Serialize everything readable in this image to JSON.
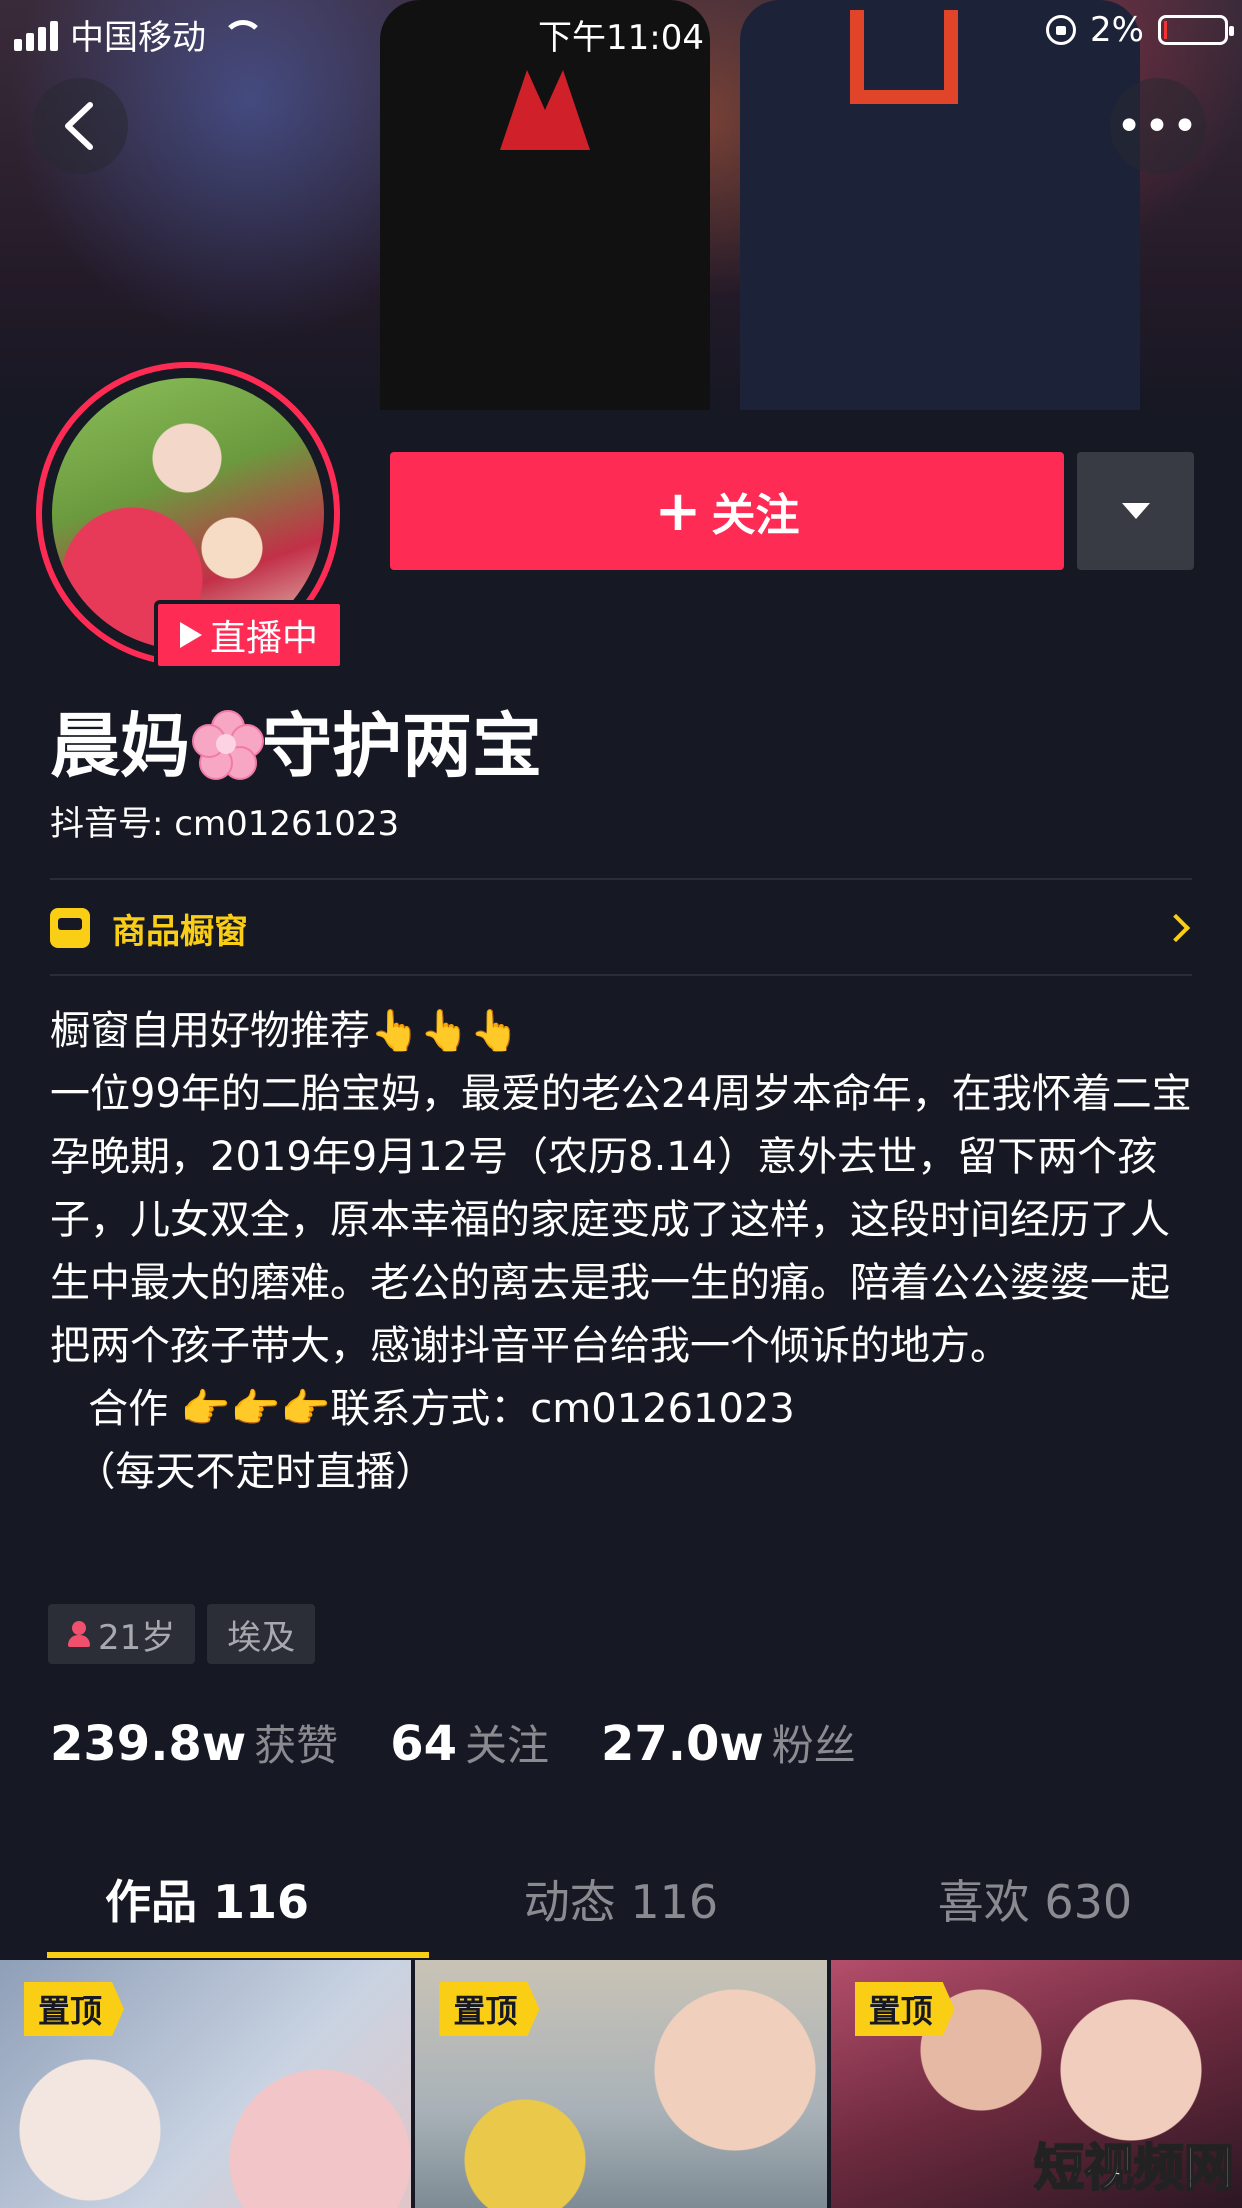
{
  "status_bar": {
    "carrier": "中国移动",
    "time": "下午11:04",
    "battery": "2%"
  },
  "header": {
    "back_icon": "chevron-left-icon",
    "more_icon": "more-dots-icon",
    "more_label": "•••"
  },
  "profile": {
    "live_badge": "直播中",
    "follow_label": "关注",
    "follow_plus": "+",
    "nickname_part1": "晨妈",
    "nickname_emoji": "cherry-blossom-icon",
    "nickname_part2": "守护两宝",
    "douyin_id": "抖音号: cm01261023"
  },
  "shop": {
    "label": "商品橱窗"
  },
  "bio": "橱窗自用好物推荐👆👆👆\n一位99年的二胎宝妈，最爱的老公24周岁本命年，在我怀着二宝孕晚期，2019年9月12号（农历8.14）意外去世，留下两个孩子，儿女双全，原本幸福的家庭变成了这样，这段时间经历了人生中最大的磨难。老公的离去是我一生的痛。陪着公公婆婆一起把两个孩子带大，感谢抖音平台给我一个倾诉的地方。\n   合作 👉👉👉联系方式：cm01261023\n  （每天不定时直播）",
  "tags": {
    "age": "21岁",
    "location": "埃及"
  },
  "stats": {
    "likes_num": "239.8w",
    "likes_label": "获赞",
    "following_num": "64",
    "following_label": "关注",
    "fans_num": "27.0w",
    "fans_label": "粉丝"
  },
  "tabs": [
    {
      "label": "作品 116",
      "active": true
    },
    {
      "label": "动态 116",
      "active": false
    },
    {
      "label": "喜欢 630",
      "active": false
    }
  ],
  "videos": [
    {
      "pin": "置顶"
    },
    {
      "pin": "置顶"
    },
    {
      "pin": "置顶"
    }
  ],
  "watermark": "短视频网",
  "colors": {
    "background": "#161823",
    "follow_red": "#fe2c55",
    "accent_yellow": "#face15"
  }
}
